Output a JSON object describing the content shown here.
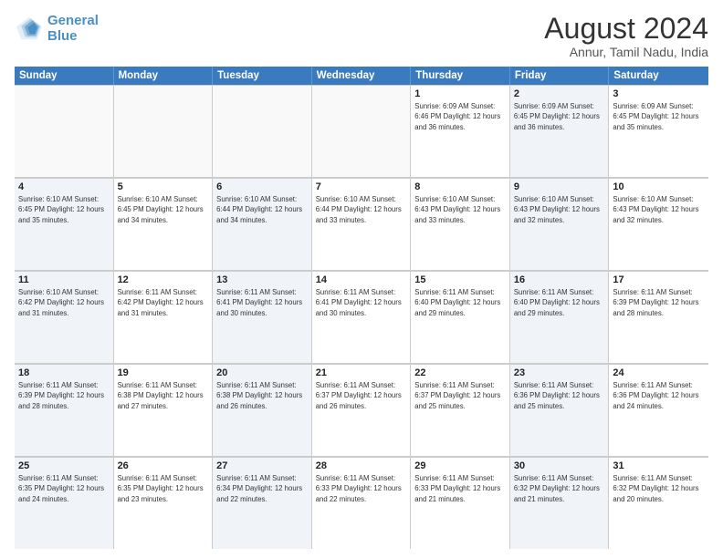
{
  "logo": {
    "line1": "General",
    "line2": "Blue"
  },
  "title": "August 2024",
  "subtitle": "Annur, Tamil Nadu, India",
  "days_of_week": [
    "Sunday",
    "Monday",
    "Tuesday",
    "Wednesday",
    "Thursday",
    "Friday",
    "Saturday"
  ],
  "weeks": [
    [
      {
        "day": "",
        "info": "",
        "empty": true
      },
      {
        "day": "",
        "info": "",
        "empty": true
      },
      {
        "day": "",
        "info": "",
        "empty": true
      },
      {
        "day": "",
        "info": "",
        "empty": true
      },
      {
        "day": "1",
        "info": "Sunrise: 6:09 AM\nSunset: 6:46 PM\nDaylight: 12 hours\nand 36 minutes.",
        "empty": false
      },
      {
        "day": "2",
        "info": "Sunrise: 6:09 AM\nSunset: 6:45 PM\nDaylight: 12 hours\nand 36 minutes.",
        "empty": false,
        "shaded": true
      },
      {
        "day": "3",
        "info": "Sunrise: 6:09 AM\nSunset: 6:45 PM\nDaylight: 12 hours\nand 35 minutes.",
        "empty": false
      }
    ],
    [
      {
        "day": "4",
        "info": "Sunrise: 6:10 AM\nSunset: 6:45 PM\nDaylight: 12 hours\nand 35 minutes.",
        "empty": false,
        "shaded": true
      },
      {
        "day": "5",
        "info": "Sunrise: 6:10 AM\nSunset: 6:45 PM\nDaylight: 12 hours\nand 34 minutes.",
        "empty": false
      },
      {
        "day": "6",
        "info": "Sunrise: 6:10 AM\nSunset: 6:44 PM\nDaylight: 12 hours\nand 34 minutes.",
        "empty": false,
        "shaded": true
      },
      {
        "day": "7",
        "info": "Sunrise: 6:10 AM\nSunset: 6:44 PM\nDaylight: 12 hours\nand 33 minutes.",
        "empty": false
      },
      {
        "day": "8",
        "info": "Sunrise: 6:10 AM\nSunset: 6:43 PM\nDaylight: 12 hours\nand 33 minutes.",
        "empty": false
      },
      {
        "day": "9",
        "info": "Sunrise: 6:10 AM\nSunset: 6:43 PM\nDaylight: 12 hours\nand 32 minutes.",
        "empty": false,
        "shaded": true
      },
      {
        "day": "10",
        "info": "Sunrise: 6:10 AM\nSunset: 6:43 PM\nDaylight: 12 hours\nand 32 minutes.",
        "empty": false
      }
    ],
    [
      {
        "day": "11",
        "info": "Sunrise: 6:10 AM\nSunset: 6:42 PM\nDaylight: 12 hours\nand 31 minutes.",
        "empty": false,
        "shaded": true
      },
      {
        "day": "12",
        "info": "Sunrise: 6:11 AM\nSunset: 6:42 PM\nDaylight: 12 hours\nand 31 minutes.",
        "empty": false
      },
      {
        "day": "13",
        "info": "Sunrise: 6:11 AM\nSunset: 6:41 PM\nDaylight: 12 hours\nand 30 minutes.",
        "empty": false,
        "shaded": true
      },
      {
        "day": "14",
        "info": "Sunrise: 6:11 AM\nSunset: 6:41 PM\nDaylight: 12 hours\nand 30 minutes.",
        "empty": false
      },
      {
        "day": "15",
        "info": "Sunrise: 6:11 AM\nSunset: 6:40 PM\nDaylight: 12 hours\nand 29 minutes.",
        "empty": false
      },
      {
        "day": "16",
        "info": "Sunrise: 6:11 AM\nSunset: 6:40 PM\nDaylight: 12 hours\nand 29 minutes.",
        "empty": false,
        "shaded": true
      },
      {
        "day": "17",
        "info": "Sunrise: 6:11 AM\nSunset: 6:39 PM\nDaylight: 12 hours\nand 28 minutes.",
        "empty": false
      }
    ],
    [
      {
        "day": "18",
        "info": "Sunrise: 6:11 AM\nSunset: 6:39 PM\nDaylight: 12 hours\nand 28 minutes.",
        "empty": false,
        "shaded": true
      },
      {
        "day": "19",
        "info": "Sunrise: 6:11 AM\nSunset: 6:38 PM\nDaylight: 12 hours\nand 27 minutes.",
        "empty": false
      },
      {
        "day": "20",
        "info": "Sunrise: 6:11 AM\nSunset: 6:38 PM\nDaylight: 12 hours\nand 26 minutes.",
        "empty": false,
        "shaded": true
      },
      {
        "day": "21",
        "info": "Sunrise: 6:11 AM\nSunset: 6:37 PM\nDaylight: 12 hours\nand 26 minutes.",
        "empty": false
      },
      {
        "day": "22",
        "info": "Sunrise: 6:11 AM\nSunset: 6:37 PM\nDaylight: 12 hours\nand 25 minutes.",
        "empty": false
      },
      {
        "day": "23",
        "info": "Sunrise: 6:11 AM\nSunset: 6:36 PM\nDaylight: 12 hours\nand 25 minutes.",
        "empty": false,
        "shaded": true
      },
      {
        "day": "24",
        "info": "Sunrise: 6:11 AM\nSunset: 6:36 PM\nDaylight: 12 hours\nand 24 minutes.",
        "empty": false
      }
    ],
    [
      {
        "day": "25",
        "info": "Sunrise: 6:11 AM\nSunset: 6:35 PM\nDaylight: 12 hours\nand 24 minutes.",
        "empty": false,
        "shaded": true
      },
      {
        "day": "26",
        "info": "Sunrise: 6:11 AM\nSunset: 6:35 PM\nDaylight: 12 hours\nand 23 minutes.",
        "empty": false
      },
      {
        "day": "27",
        "info": "Sunrise: 6:11 AM\nSunset: 6:34 PM\nDaylight: 12 hours\nand 22 minutes.",
        "empty": false,
        "shaded": true
      },
      {
        "day": "28",
        "info": "Sunrise: 6:11 AM\nSunset: 6:33 PM\nDaylight: 12 hours\nand 22 minutes.",
        "empty": false
      },
      {
        "day": "29",
        "info": "Sunrise: 6:11 AM\nSunset: 6:33 PM\nDaylight: 12 hours\nand 21 minutes.",
        "empty": false
      },
      {
        "day": "30",
        "info": "Sunrise: 6:11 AM\nSunset: 6:32 PM\nDaylight: 12 hours\nand 21 minutes.",
        "empty": false,
        "shaded": true
      },
      {
        "day": "31",
        "info": "Sunrise: 6:11 AM\nSunset: 6:32 PM\nDaylight: 12 hours\nand 20 minutes.",
        "empty": false
      }
    ]
  ]
}
